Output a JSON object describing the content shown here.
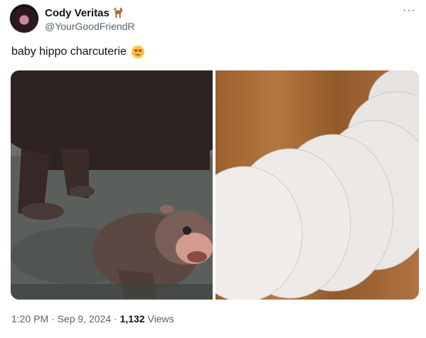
{
  "tweet": {
    "display_name": "Cody Veritas",
    "handle": "@YourGoodFriendR",
    "text": "baby hippo charcuterie",
    "emoji_icon": "heart-eyes-emoji-icon",
    "name_icon": "deer-emoji-icon",
    "more_icon": "more-options-icon",
    "time": "1:20 PM",
    "date": "Sep 9, 2024",
    "separator": "·",
    "views_count": "1,132",
    "views_label": "Views"
  },
  "colors": {
    "text": "#0f1419",
    "secondary": "#536471"
  }
}
